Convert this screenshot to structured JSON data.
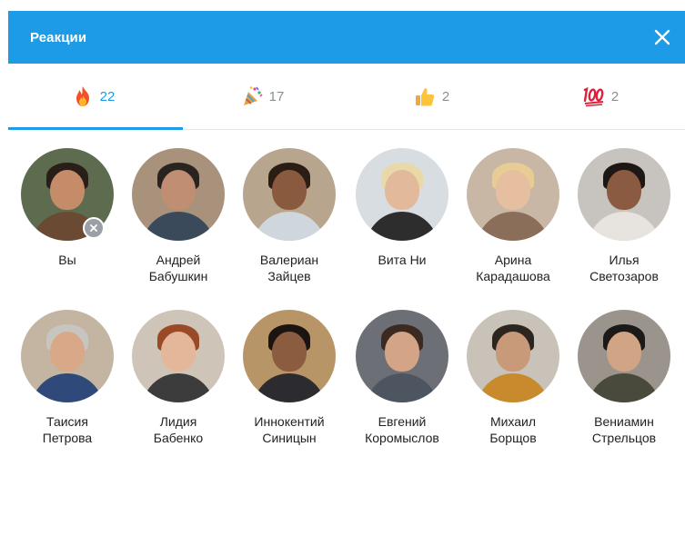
{
  "dialog": {
    "title": "Реакции"
  },
  "tabs": [
    {
      "emoji": "fire-icon",
      "count": "22",
      "active": true
    },
    {
      "emoji": "party-popper-icon",
      "count": "17",
      "active": false
    },
    {
      "emoji": "thumbs-up-icon",
      "count": "2",
      "active": false
    },
    {
      "emoji": "hundred-points-icon",
      "count": "2",
      "active": false
    }
  ],
  "people": [
    {
      "name": "Вы",
      "removable": true
    },
    {
      "name": "Андрей\nБабушкин"
    },
    {
      "name": "Валериан\nЗайцев"
    },
    {
      "name": "Вита Ни"
    },
    {
      "name": "Арина\nКарадашова"
    },
    {
      "name": "Илья\nСветозаров"
    },
    {
      "name": "Таисия\nПетрова"
    },
    {
      "name": "Лидия\nБабенко"
    },
    {
      "name": "Иннокентий\nСиницын"
    },
    {
      "name": "Евгений\nКоромыслов"
    },
    {
      "name": "Михаил\nБорщов"
    },
    {
      "name": "Вениамин\nСтрельцов"
    }
  ],
  "colors": {
    "accent": "#1d9be6",
    "header_text": "#ffffff"
  }
}
